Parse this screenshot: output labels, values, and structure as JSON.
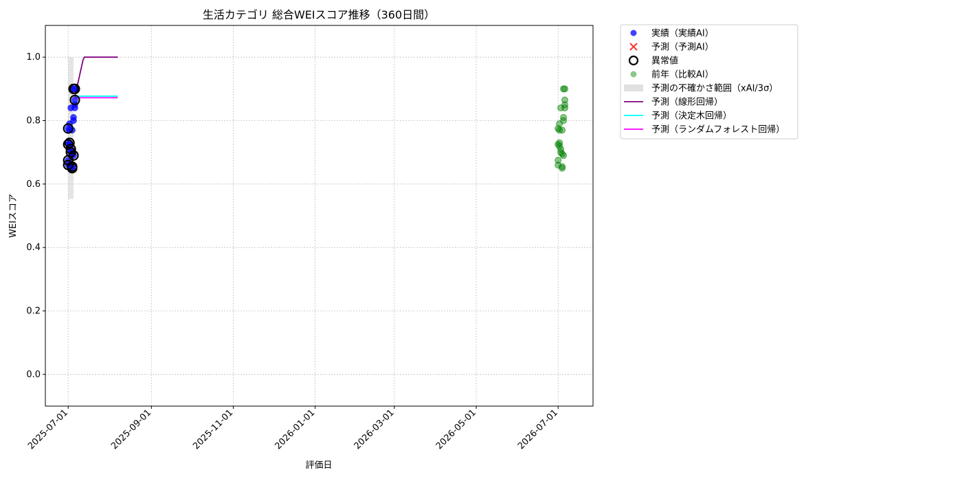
{
  "chart_data": {
    "type": "scatter",
    "title": "生活カテゴリ 総合WEIスコア推移（360日間）",
    "xlabel": "評価日",
    "ylabel": "WEIスコア",
    "xlim": [
      "2025-06-14",
      "2026-07-27"
    ],
    "ylim": [
      -0.1,
      1.1
    ],
    "yticks": [
      0.0,
      0.2,
      0.4,
      0.6,
      0.8,
      1.0
    ],
    "ytick_labels": [
      "0.0",
      "0.2",
      "0.4",
      "0.6",
      "0.8",
      "1.0"
    ],
    "xticks": [
      "2025-07-01",
      "2025-09-01",
      "2025-11-01",
      "2026-01-01",
      "2026-03-01",
      "2026-05-01",
      "2026-07-01"
    ],
    "grid": true,
    "legend_position": "outside upper right",
    "colors": {
      "actual": "#0000ff",
      "predicted": "#ff0000",
      "anomaly": "#000000",
      "last_year": "#008000",
      "band": "#d3d3d3",
      "linear": "#800080",
      "tree": "#00ffff",
      "forest": "#ff00ff"
    },
    "legend": [
      {
        "key": "actual",
        "label": "実績（実績AI）"
      },
      {
        "key": "predicted",
        "label": "予測（予測AI）"
      },
      {
        "key": "anomaly",
        "label": "異常値"
      },
      {
        "key": "last_year",
        "label": "前年（比較AI）"
      },
      {
        "key": "band",
        "label": "予測の不確かさ範囲（xAI/3σ）"
      },
      {
        "key": "linear",
        "label": "予測（線形回帰）"
      },
      {
        "key": "tree",
        "label": "予測（決定木回帰）"
      },
      {
        "key": "forest",
        "label": "予測（ランダムフォレスト回帰）"
      }
    ],
    "actual": [
      {
        "x": "2025-07-01",
        "y": 0.775
      },
      {
        "x": "2025-07-01",
        "y": 0.725
      },
      {
        "x": "2025-07-01",
        "y": 0.675
      },
      {
        "x": "2025-07-01",
        "y": 0.66
      },
      {
        "x": "2025-07-02",
        "y": 0.79
      },
      {
        "x": "2025-07-02",
        "y": 0.77
      },
      {
        "x": "2025-07-02",
        "y": 0.73
      },
      {
        "x": "2025-07-02",
        "y": 0.72
      },
      {
        "x": "2025-07-03",
        "y": 0.71
      },
      {
        "x": "2025-07-03",
        "y": 0.84
      },
      {
        "x": "2025-07-03",
        "y": 0.7
      },
      {
        "x": "2025-07-04",
        "y": 0.655
      },
      {
        "x": "2025-07-04",
        "y": 0.65
      },
      {
        "x": "2025-07-04",
        "y": 0.695
      },
      {
        "x": "2025-07-04",
        "y": 0.77
      },
      {
        "x": "2025-07-05",
        "y": 0.81
      },
      {
        "x": "2025-07-05",
        "y": 0.8
      },
      {
        "x": "2025-07-05",
        "y": 0.69
      },
      {
        "x": "2025-07-05",
        "y": 0.9
      },
      {
        "x": "2025-07-06",
        "y": 0.865
      },
      {
        "x": "2025-07-06",
        "y": 0.84
      },
      {
        "x": "2025-07-06",
        "y": 0.85
      },
      {
        "x": "2025-07-06",
        "y": 0.9
      }
    ],
    "anomalies": [
      {
        "x": "2025-07-01",
        "y": 0.775
      },
      {
        "x": "2025-07-01",
        "y": 0.725
      },
      {
        "x": "2025-07-01",
        "y": 0.675
      },
      {
        "x": "2025-07-01",
        "y": 0.66
      },
      {
        "x": "2025-07-02",
        "y": 0.73
      },
      {
        "x": "2025-07-03",
        "y": 0.71
      },
      {
        "x": "2025-07-03",
        "y": 0.7
      },
      {
        "x": "2025-07-04",
        "y": 0.655
      },
      {
        "x": "2025-07-04",
        "y": 0.65
      },
      {
        "x": "2025-07-05",
        "y": 0.69
      },
      {
        "x": "2025-07-05",
        "y": 0.9
      },
      {
        "x": "2025-07-06",
        "y": 0.865
      },
      {
        "x": "2025-07-06",
        "y": 0.9
      }
    ],
    "last_year": [
      {
        "x": "2026-07-01",
        "y": 0.775
      },
      {
        "x": "2026-07-01",
        "y": 0.725
      },
      {
        "x": "2026-07-01",
        "y": 0.675
      },
      {
        "x": "2026-07-01",
        "y": 0.66
      },
      {
        "x": "2026-07-02",
        "y": 0.79
      },
      {
        "x": "2026-07-02",
        "y": 0.77
      },
      {
        "x": "2026-07-02",
        "y": 0.73
      },
      {
        "x": "2026-07-02",
        "y": 0.72
      },
      {
        "x": "2026-07-03",
        "y": 0.71
      },
      {
        "x": "2026-07-03",
        "y": 0.84
      },
      {
        "x": "2026-07-03",
        "y": 0.7
      },
      {
        "x": "2026-07-04",
        "y": 0.655
      },
      {
        "x": "2026-07-04",
        "y": 0.65
      },
      {
        "x": "2026-07-04",
        "y": 0.695
      },
      {
        "x": "2026-07-04",
        "y": 0.77
      },
      {
        "x": "2026-07-05",
        "y": 0.81
      },
      {
        "x": "2026-07-05",
        "y": 0.8
      },
      {
        "x": "2026-07-05",
        "y": 0.69
      },
      {
        "x": "2026-07-05",
        "y": 0.9
      },
      {
        "x": "2026-07-06",
        "y": 0.865
      },
      {
        "x": "2026-07-06",
        "y": 0.84
      },
      {
        "x": "2026-07-06",
        "y": 0.85
      },
      {
        "x": "2026-07-06",
        "y": 0.9
      }
    ],
    "uncertainty_band": {
      "x_start": "2025-07-01",
      "x_end": "2025-07-05",
      "y_low": 0.553,
      "y_high": 1.0
    },
    "linear_regression": [
      {
        "x": "2025-07-06",
        "y": 0.875
      },
      {
        "x": "2025-07-12",
        "y": 0.99
      },
      {
        "x": "2025-07-13",
        "y": 1.0
      },
      {
        "x": "2025-07-20",
        "y": 1.0
      },
      {
        "x": "2025-08-07",
        "y": 1.0
      }
    ],
    "decision_tree": [
      {
        "x": "2025-07-06",
        "y": 0.877
      },
      {
        "x": "2025-08-07",
        "y": 0.877
      }
    ],
    "random_forest": [
      {
        "x": "2025-07-06",
        "y": 0.872
      },
      {
        "x": "2025-08-07",
        "y": 0.872
      }
    ]
  }
}
